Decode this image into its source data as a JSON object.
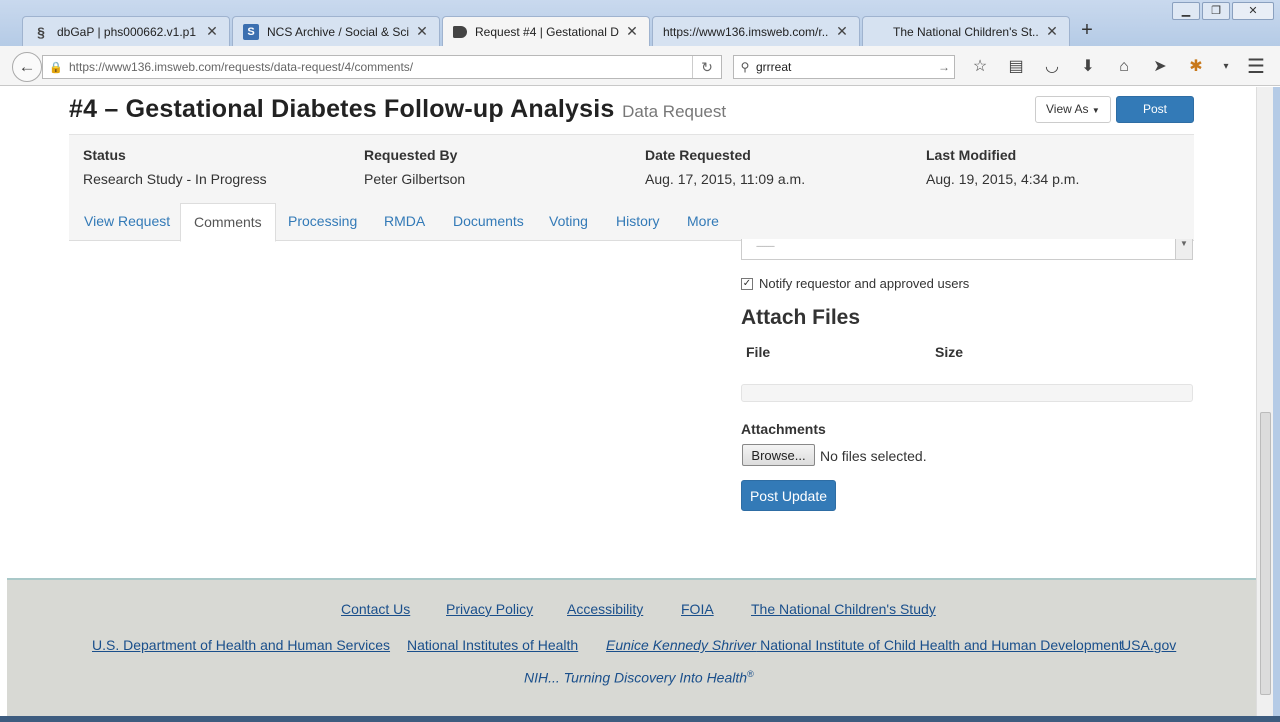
{
  "browser": {
    "tabs": [
      {
        "title": "dbGaP | phs000662.v1.p1 | ...",
        "icon": "dbgap-dna-icon"
      },
      {
        "title": "NCS Archive / Social & Sci...",
        "icon": "ncs-s-icon"
      },
      {
        "title": "Request #4 | Gestational Di...",
        "icon": "tag-icon",
        "active": true
      },
      {
        "title": "https://www136.imsweb.com/r...",
        "icon": ""
      },
      {
        "title": "The National Children's St...",
        "icon": ""
      }
    ],
    "url": "https://www136.imsweb.com/requests/data-request/4/comments/",
    "search_value": "grrreat"
  },
  "header": {
    "title": "#4 – Gestational Diabetes Follow-up Analysis",
    "subtitle": "Data Request",
    "view_as_label": "View As",
    "post_update_label": "Post Update"
  },
  "summary": {
    "status_label": "Status",
    "status_value": "Research Study - In Progress",
    "requested_by_label": "Requested By",
    "requested_by_value": "Peter Gilbertson",
    "date_requested_label": "Date Requested",
    "date_requested_value": "Aug. 17, 2015, 11:09 a.m.",
    "last_modified_label": "Last Modified",
    "last_modified_value": "Aug. 19, 2015, 4:34 p.m."
  },
  "tabs": [
    "View Request",
    "Comments",
    "Processing",
    "RMDA",
    "Documents",
    "Voting",
    "History",
    "More"
  ],
  "active_tab": "Comments",
  "form": {
    "select_placeholder": "---------",
    "notify_label": "Notify requestor and approved users",
    "notify_checked": true,
    "attach_heading": "Attach Files",
    "col_file": "File",
    "col_size": "Size",
    "attachments_label": "Attachments",
    "browse_label": "Browse...",
    "no_files": "No files selected.",
    "post_update_label": "Post Update"
  },
  "footer": {
    "row1": [
      "Contact Us",
      "Privacy Policy",
      "Accessibility",
      "FOIA",
      "The National Children's Study"
    ],
    "hhs": "U.S. Department of Health and Human Services",
    "nih": "National Institutes of Health",
    "nichd_italic": "Eunice Kennedy Shriver",
    "nichd_rest": " National Institute of Child Health and Human Development",
    "usagov": "USA.gov",
    "tagline": "NIH... Turning Discovery Into Health",
    "tagline_mark": "®"
  }
}
